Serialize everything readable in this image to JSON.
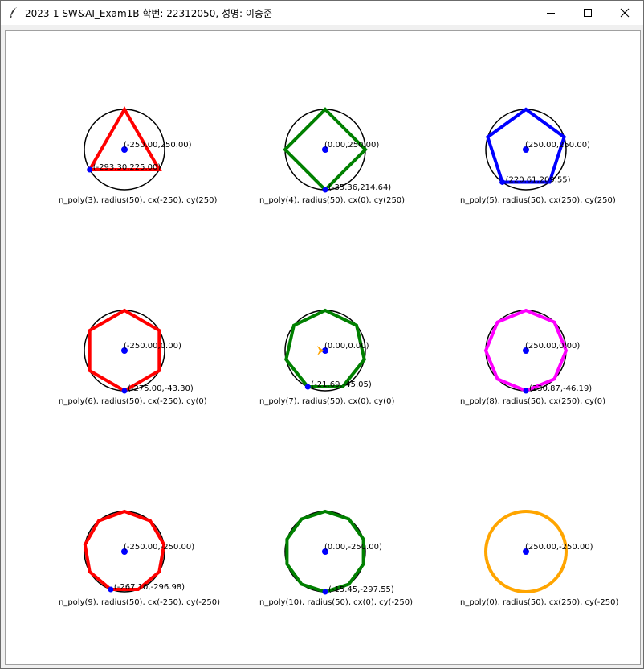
{
  "window": {
    "title": "2023-1 SW&AI_Exam1B 학번: 22312050, 성명: 이승준"
  },
  "icons": {
    "app": "feather-icon",
    "minimize": "minimize-icon",
    "maximize": "maximize-icon",
    "close": "close-icon"
  },
  "shapes": [
    {
      "n": 3,
      "color": "#ff0000",
      "center_label": "(-250.00,250.00)",
      "vertex_label": "(-293.30,225.00)",
      "caption": "n_poly(3), radius(50), cx(-250), cy(250)"
    },
    {
      "n": 4,
      "color": "#008000",
      "center_label": "(0.00,250.00)",
      "vertex_label": "(-35.36,214.64)",
      "caption": "n_poly(4), radius(50), cx(0), cy(250)"
    },
    {
      "n": 5,
      "color": "#0000ff",
      "center_label": "(250.00,250.00)",
      "vertex_label": "(220.61,209.55)",
      "caption": "n_poly(5), radius(50), cx(250), cy(250)"
    },
    {
      "n": 6,
      "color": "#ff0000",
      "center_label": "(-250.00,0.00)",
      "vertex_label": "(-275.00,-43.30)",
      "caption": "n_poly(6), radius(50), cx(-250), cy(0)"
    },
    {
      "n": 7,
      "color": "#008000",
      "center_label": "(0.00,0.00)",
      "vertex_label": "(-21.69,-45.05)",
      "caption": "n_poly(7), radius(50), cx(0), cy(0)"
    },
    {
      "n": 8,
      "color": "#ff00ff",
      "center_label": "(250.00,0.00)",
      "vertex_label": "(230.87,-46.19)",
      "caption": "n_poly(8), radius(50), cx(250), cy(0)"
    },
    {
      "n": 9,
      "color": "#ff0000",
      "center_label": "(-250.00,-250.00)",
      "vertex_label": "(-267.10,-296.98)",
      "caption": "n_poly(9), radius(50), cx(-250), cy(-250)"
    },
    {
      "n": 10,
      "color": "#008000",
      "center_label": "(0.00,-250.00)",
      "vertex_label": "(-15.45,-297.55)",
      "caption": "n_poly(10), radius(50), cx(0), cy(-250)"
    },
    {
      "n": 0,
      "color": "#ffa500",
      "center_label": "(250.00,-250.00)",
      "vertex_label": "",
      "caption": "n_poly(0), radius(50), cx(250), cy(-250)"
    }
  ],
  "turtle_color": "#ffa500"
}
